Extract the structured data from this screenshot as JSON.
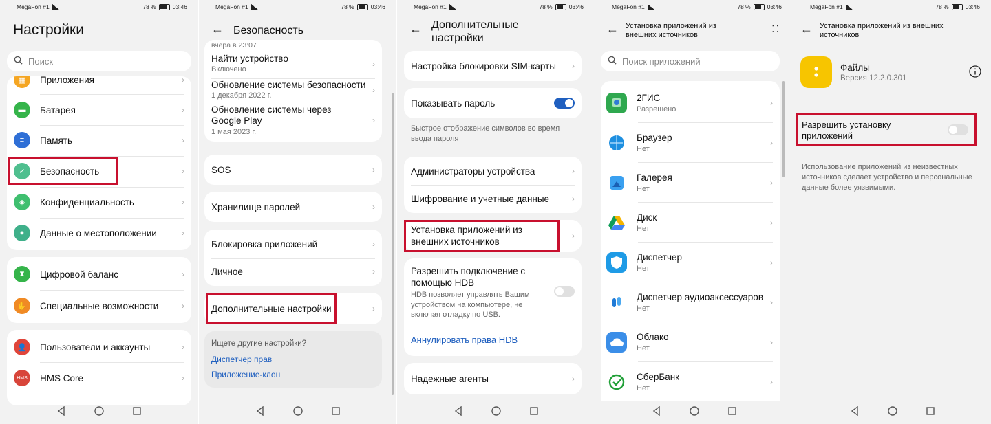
{
  "status": {
    "carrier": "MegaFon #1",
    "battery": "78 %",
    "time": "03:46"
  },
  "screen1": {
    "title": "Настройки",
    "search_placeholder": "Поиск",
    "items": [
      {
        "label": "Приложения"
      },
      {
        "label": "Батарея"
      },
      {
        "label": "Память"
      },
      {
        "label": "Безопасность"
      },
      {
        "label": "Конфиденциальность"
      },
      {
        "label": "Данные о местоположении"
      }
    ],
    "group2": [
      {
        "label": "Цифровой баланс"
      },
      {
        "label": "Специальные возможности"
      }
    ],
    "group3": [
      {
        "label": "Пользователи и аккаунты"
      },
      {
        "label": "HMS Core"
      }
    ],
    "hms_icon_text": "HMS"
  },
  "screen2": {
    "title": "Безопасность",
    "top_partial": "вчера в 23:07",
    "items": [
      {
        "label": "Найти устройство",
        "sub": "Включено"
      },
      {
        "label": "Обновление системы безопасности",
        "sub": "1 декабря 2022 г."
      },
      {
        "label": "Обновление системы через Google Play",
        "sub": "1 мая 2023 г."
      }
    ],
    "sos": "SOS",
    "passwords": "Хранилище паролей",
    "app_lock": "Блокировка приложений",
    "personal": "Личное",
    "advanced": "Дополнительные настройки",
    "looking": "Ищете другие настройки?",
    "links": [
      "Диспетчер прав",
      "Приложение-клон"
    ]
  },
  "screen3": {
    "title": "Дополнительные настройки",
    "sim_lock": "Настройка блокировки SIM-карты",
    "show_password": "Показывать пароль",
    "show_password_desc": "Быстрое отображение символов во время ввода пароля",
    "admins": "Администраторы устройства",
    "encryption": "Шифрование и учетные данные",
    "install_external": "Установка приложений из внешних источников",
    "hdb_title": "Разрешить подключение с помощью HDB",
    "hdb_desc": "HDB позволяет управлять Вашим устройством на компьютере, не включая отладку по USB.",
    "hdb_revoke": "Аннулировать права HDB",
    "trusted_agents": "Надежные агенты"
  },
  "screen4": {
    "title": "Установка приложений из внешних источников",
    "search_placeholder": "Поиск приложений",
    "apps": [
      {
        "name": "2ГИС",
        "status": "Разрешено"
      },
      {
        "name": "Браузер",
        "status": "Нет"
      },
      {
        "name": "Галерея",
        "status": "Нет"
      },
      {
        "name": "Диск",
        "status": "Нет"
      },
      {
        "name": "Диспетчер",
        "status": "Нет"
      },
      {
        "name": "Диспетчер аудиоаксессуаров",
        "status": "Нет"
      },
      {
        "name": "Облако",
        "status": "Нет"
      },
      {
        "name": "СберБанк",
        "status": "Нет"
      }
    ]
  },
  "screen5": {
    "title": "Установка приложений из внешних источников",
    "app_name": "Файлы",
    "app_version": "Версия 12.2.0.301",
    "allow": "Разрешить установку приложений",
    "warning": "Использование приложений из неизвестных источников сделает устройство и персональные данные более уязвимыми."
  },
  "colors": {
    "accent": "#1f5fbf",
    "highlight": "#c8102e",
    "toggle_on": "#1f5fbf"
  }
}
